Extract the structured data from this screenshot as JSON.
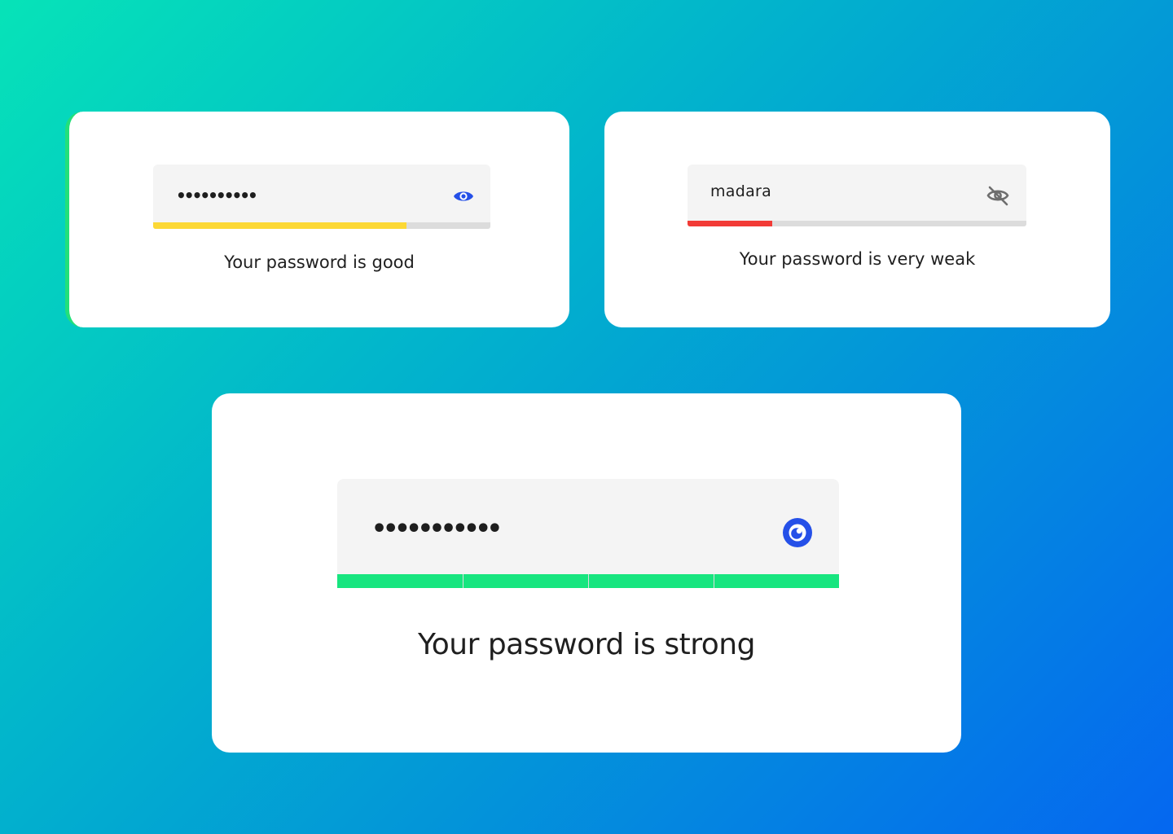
{
  "colors": {
    "good": "#fcd835",
    "very_weak": "#f23b36",
    "strong": "#17e57f",
    "eye_icon": "#2550e8",
    "eye_off_icon": "#6e6e6e",
    "track": "#dcdcdc"
  },
  "cards": {
    "good": {
      "password_masked": "••••••••••",
      "visibility_icon": "eye-icon",
      "strength_fraction": 0.75,
      "message": "Your password is good"
    },
    "very_weak": {
      "password_value": "madara",
      "visibility_icon": "eye-off-icon",
      "strength_fraction": 0.25,
      "message": "Your password is very weak"
    },
    "strong": {
      "password_masked": "•••••••••••",
      "visibility_icon": "eye-icon",
      "strength_segments_filled": 4,
      "strength_segments_total": 4,
      "message": "Your password is strong"
    }
  }
}
